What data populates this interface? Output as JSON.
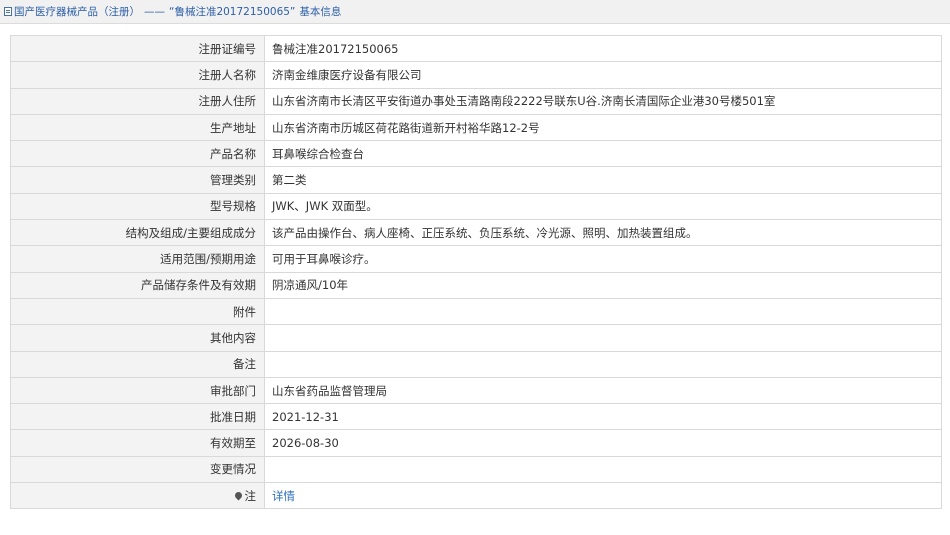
{
  "breadcrumb": {
    "category": "国产医疗器械产品（注册）",
    "separator": "——",
    "record": "“鲁械注准20172150065”",
    "suffix": "基本信息"
  },
  "rows": [
    {
      "label": "注册证编号",
      "value": "鲁械注准20172150065"
    },
    {
      "label": "注册人名称",
      "value": "济南金维康医疗设备有限公司"
    },
    {
      "label": "注册人住所",
      "value": "山东省济南市长清区平安街道办事处玉清路南段2222号联东U谷.济南长清国际企业港30号楼501室"
    },
    {
      "label": "生产地址",
      "value": "山东省济南市历城区荷花路街道新开村裕华路12-2号"
    },
    {
      "label": "产品名称",
      "value": "耳鼻喉综合检查台"
    },
    {
      "label": "管理类别",
      "value": "第二类"
    },
    {
      "label": "型号规格",
      "value": "JWK、JWK 双面型。"
    },
    {
      "label": "结构及组成/主要组成成分",
      "value": "该产品由操作台、病人座椅、正压系统、负压系统、冷光源、照明、加热装置组成。"
    },
    {
      "label": "适用范围/预期用途",
      "value": "可用于耳鼻喉诊疗。"
    },
    {
      "label": "产品储存条件及有效期",
      "value": "阴凉通风/10年"
    },
    {
      "label": "附件",
      "value": ""
    },
    {
      "label": "其他内容",
      "value": ""
    },
    {
      "label": "备注",
      "value": ""
    },
    {
      "label": "审批部门",
      "value": "山东省药品监督管理局"
    },
    {
      "label": "批准日期",
      "value": "2021-12-31"
    },
    {
      "label": "有效期至",
      "value": "2026-08-30"
    },
    {
      "label": "变更情况",
      "value": ""
    }
  ],
  "note_row": {
    "label": "注",
    "link": "详情"
  }
}
